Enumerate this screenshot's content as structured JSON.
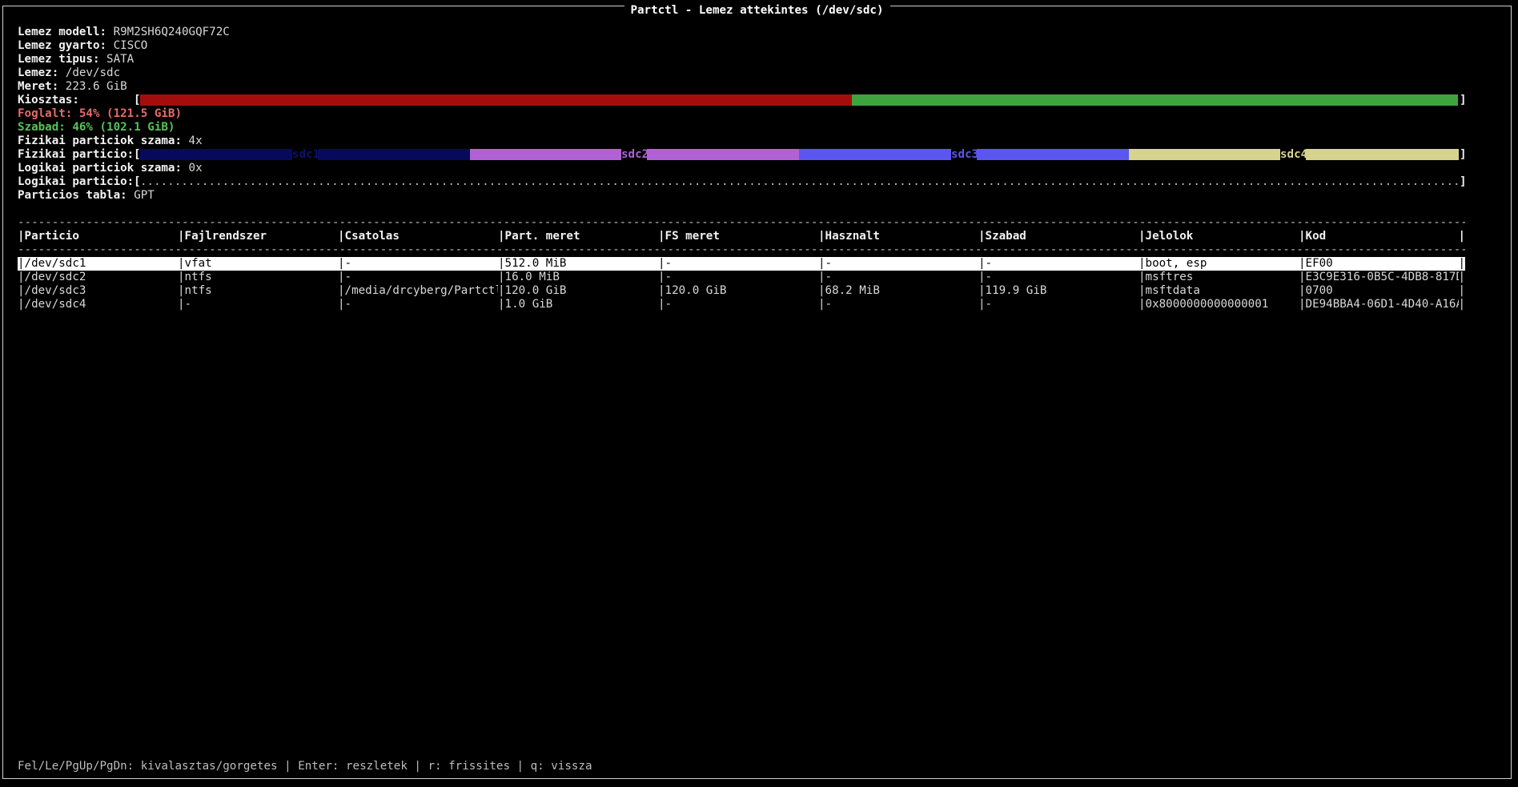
{
  "window": {
    "title": "Partctl - Lemez attekintes (/dev/sdc)"
  },
  "info": {
    "model": {
      "label": "Lemez modell:",
      "value": "R9M2SH6Q240GQF72C"
    },
    "vendor": {
      "label": "Lemez gyarto:",
      "value": "CISCO"
    },
    "type": {
      "label": "Lemez tipus:",
      "value": "SATA"
    },
    "disk": {
      "label": "Lemez:",
      "value": "/dev/sdc"
    },
    "size": {
      "label": "Meret:",
      "value": "223.6 GiB"
    },
    "allocation_label": "Kiosztas:",
    "used_text": "Foglalt: 54% (121.5 GiB)",
    "free_text": "Szabad: 46% (102.1 GiB)",
    "phys_count": {
      "label": "Fizikai particiok szama:",
      "value": "4x"
    },
    "phys_label": "Fizikai particio:",
    "log_count": {
      "label": "Logikai particiok szama:",
      "value": "0x"
    },
    "log_label": "Logikai particio:",
    "table_type": {
      "label": "Particios tabla:",
      "value": "GPT"
    }
  },
  "usage": {
    "used_fraction": 0.54,
    "free_fraction": 0.46,
    "used_color": "#a50d0d",
    "free_color": "#3fa43f"
  },
  "partitions_bar": [
    {
      "label": "sdc1",
      "color": "#070a5c",
      "label_color": "#0b1170"
    },
    {
      "label": "sdc2",
      "color": "#b161d6",
      "label_color": "#b161d6"
    },
    {
      "label": "sdc3",
      "color": "#5a56ef",
      "label_color": "#5a56ef"
    },
    {
      "label": "sdc4",
      "color": "#d6d38d",
      "label_color": "#d6d38d"
    }
  ],
  "table": {
    "headers": [
      "|Particio",
      "|Fajlrendszer",
      "|Csatolas",
      "|Part. meret",
      "|FS meret",
      "|Hasznalt",
      "|Szabad",
      "|Jelolok",
      "|Kod"
    ],
    "rows": [
      [
        "|/dev/sdc1",
        "|vfat",
        "|-",
        "|512.0 MiB",
        "|-",
        "|-",
        "|-",
        "|boot, esp",
        "|EF00"
      ],
      [
        "|/dev/sdc2",
        "|ntfs",
        "|-",
        "|16.0 MiB",
        "|-",
        "|-",
        "|-",
        "|msftres",
        "|E3C9E316-0B5C-4DB8-817D~"
      ],
      [
        "|/dev/sdc3",
        "|ntfs",
        "|/media/drcyberg/Partctl",
        "|120.0 GiB",
        "|120.0 GiB",
        "|68.2 MiB",
        "|119.9 GiB",
        "|msftdata",
        "|0700"
      ],
      [
        "|/dev/sdc4",
        "|-",
        "|-",
        "|1.0 GiB",
        "|-",
        "|-",
        "|-",
        "|0x8000000000000001",
        "|DE94BBA4-06D1-4D40-A16A~"
      ]
    ],
    "end_marker": "|"
  },
  "footer": "Fel/Le/PgUp/PgDn: kivalasztas/gorgetes | Enter: reszletek | r: frissites | q: vissza"
}
